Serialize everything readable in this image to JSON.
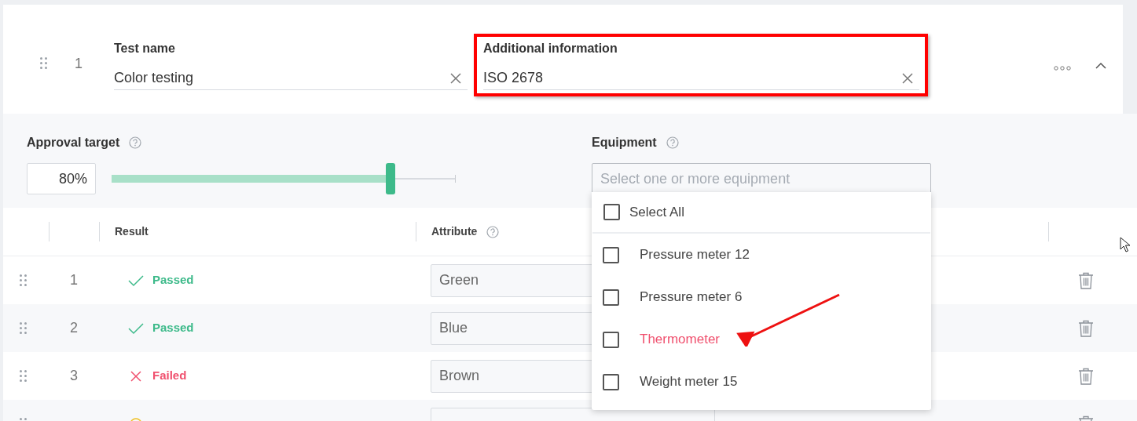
{
  "header": {
    "index": "1",
    "fields": [
      {
        "label": "Test name",
        "value": "Color testing",
        "highlighted": false
      },
      {
        "label": "Additional information",
        "value": "ISO 2678",
        "highlighted": true
      }
    ]
  },
  "approval": {
    "label": "Approval target",
    "reading": "80%",
    "level": 0.81
  },
  "equipment": {
    "label": "Equipment",
    "placeholder": "Select one or more equipment",
    "expanded": true,
    "select_all": {
      "label": "Select All",
      "checked": false
    },
    "options": [
      {
        "label": "Pressure meter 12",
        "checked": false,
        "highlighted": false
      },
      {
        "label": "Pressure meter 6",
        "checked": false,
        "highlighted": false
      },
      {
        "label": "Thermometer",
        "checked": false,
        "highlighted": true
      },
      {
        "label": "Weight meter 15",
        "checked": false,
        "highlighted": false
      }
    ]
  },
  "table": {
    "columns": [
      "Result",
      "Attribute"
    ],
    "rows": [
      {
        "index": "1",
        "kind": "passed",
        "result": "Passed",
        "attribute": "Green"
      },
      {
        "index": "2",
        "kind": "passed",
        "result": "Passed",
        "attribute": "Blue"
      },
      {
        "index": "3",
        "kind": "failed",
        "result": "Failed",
        "attribute": "Brown"
      },
      {
        "kind": "warning"
      }
    ]
  }
}
